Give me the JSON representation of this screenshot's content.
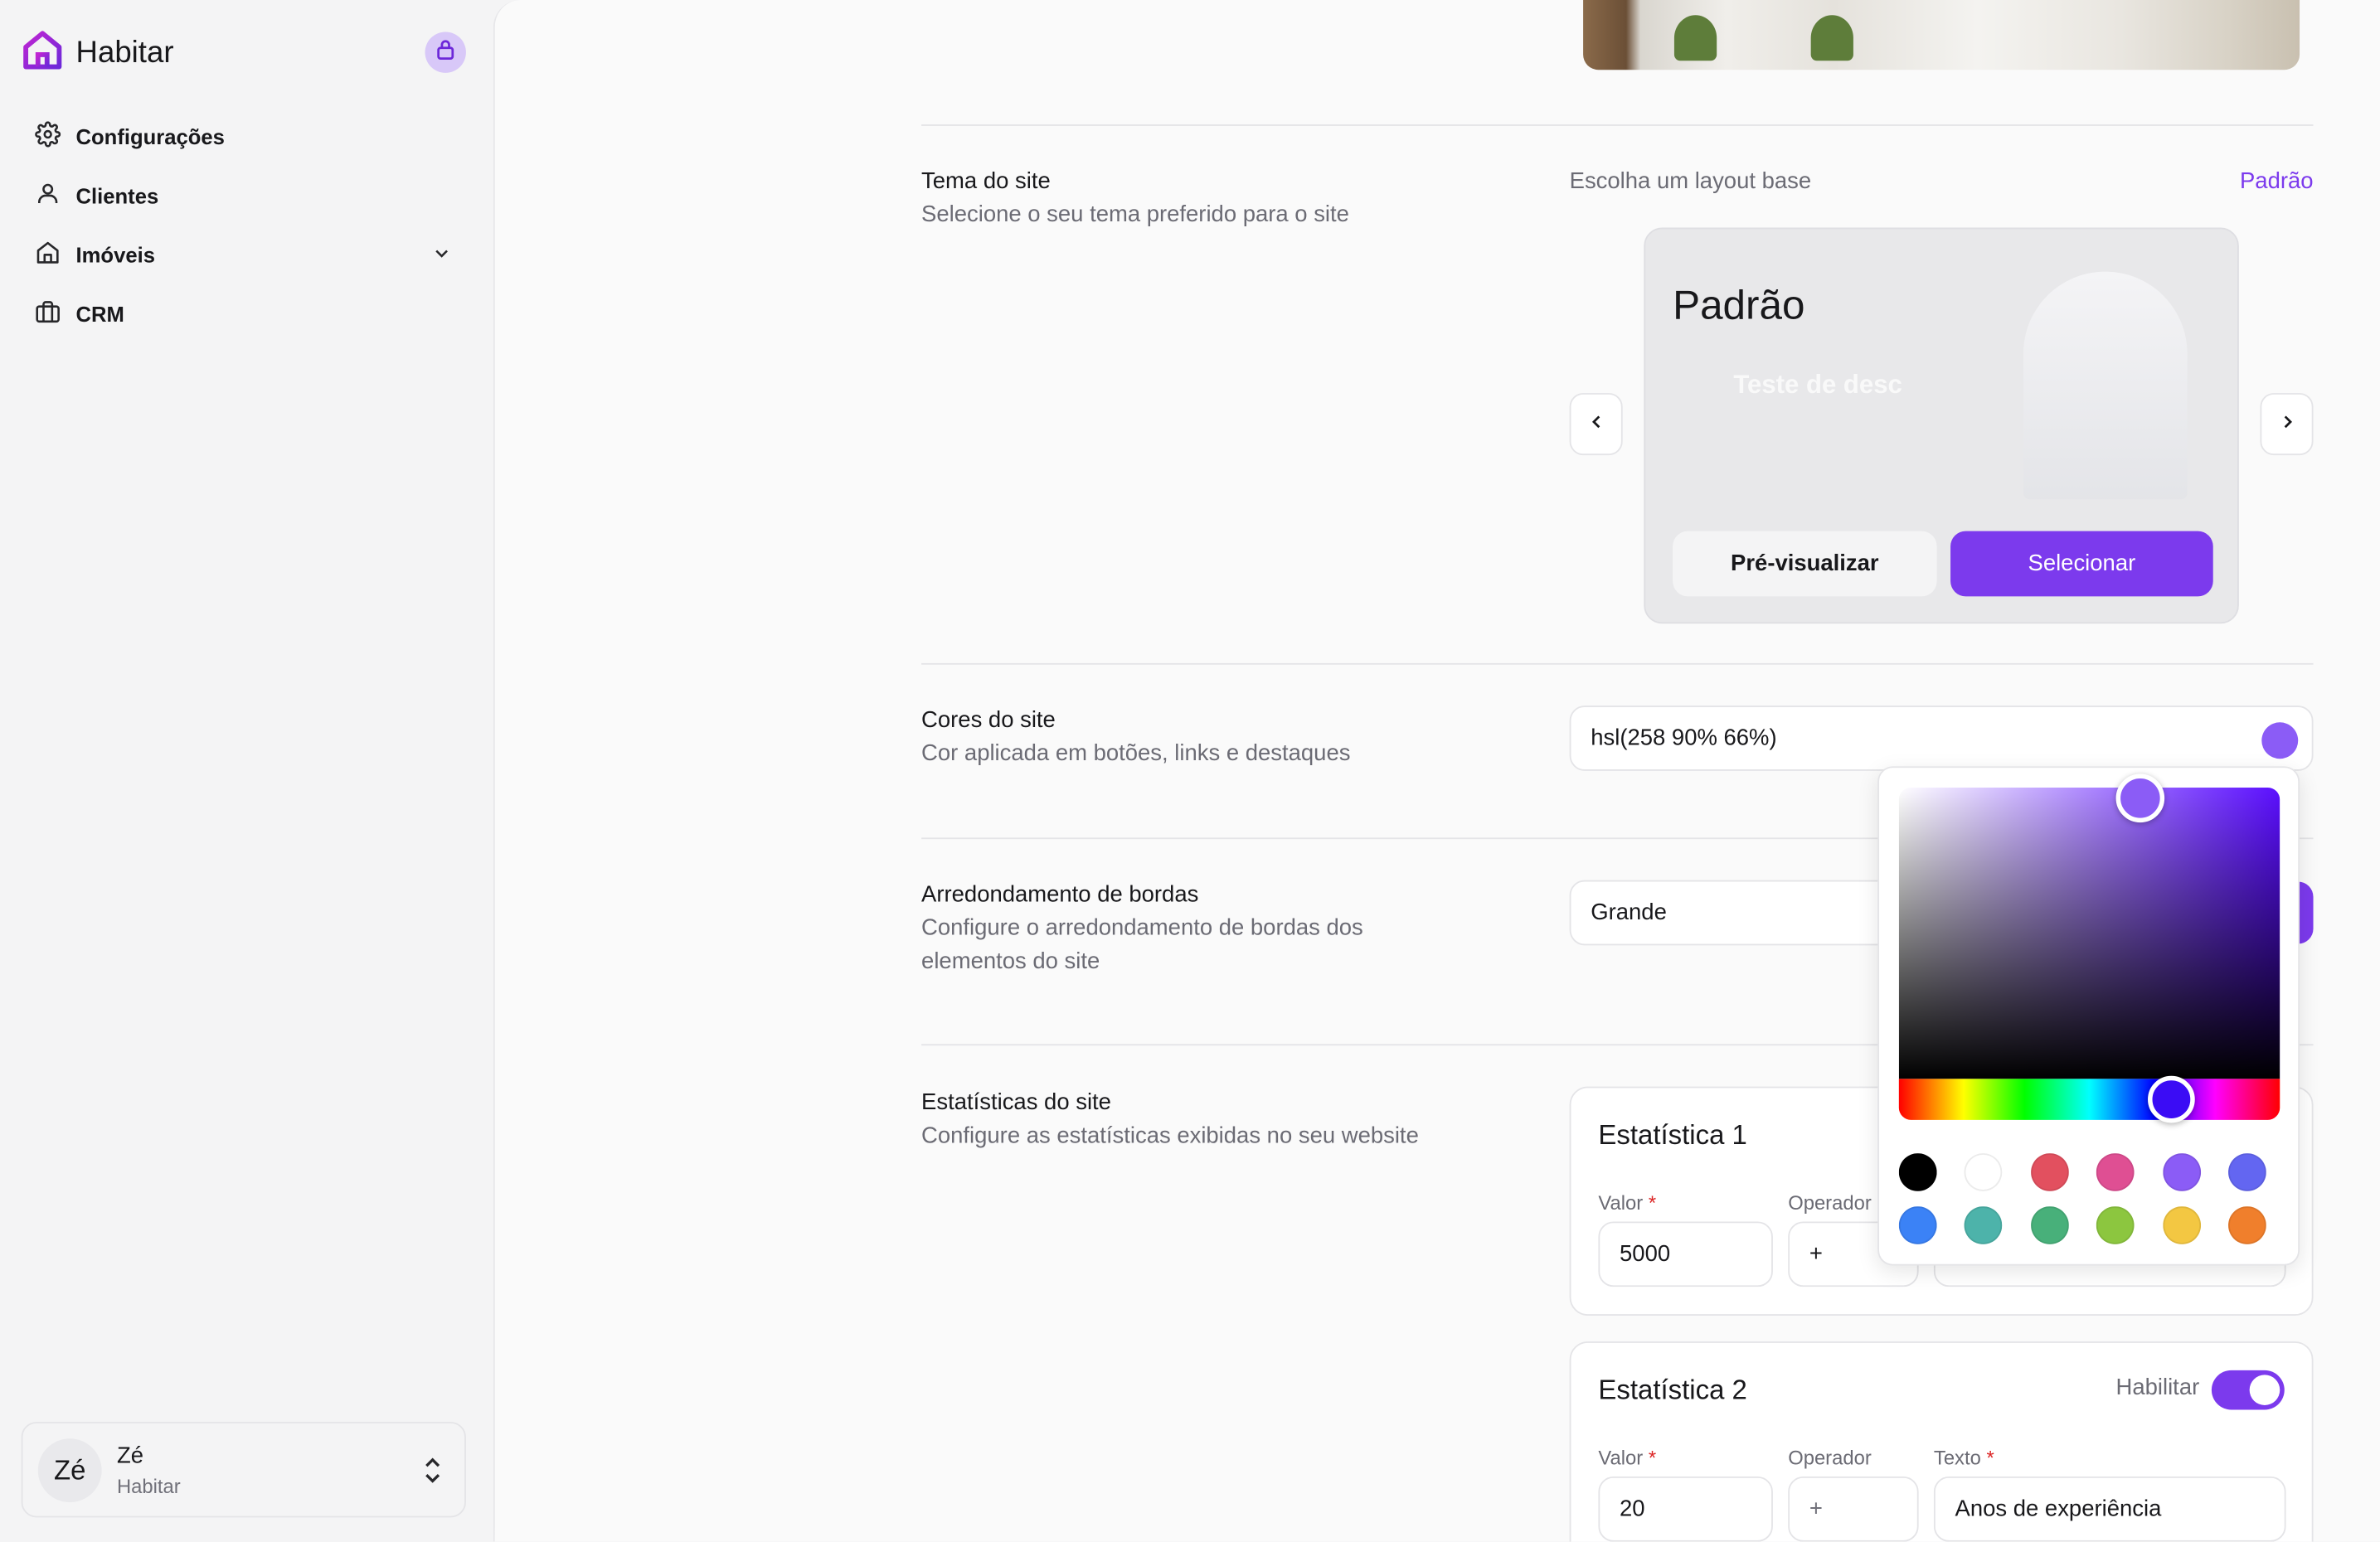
{
  "app": {
    "name": "Habitar"
  },
  "sidebar": {
    "items": [
      {
        "label": "Configurações",
        "icon": "gear-icon"
      },
      {
        "label": "Clientes",
        "icon": "user-icon"
      },
      {
        "label": "Imóveis",
        "icon": "home-icon"
      },
      {
        "label": "CRM",
        "icon": "briefcase-icon"
      }
    ]
  },
  "user": {
    "initials": "Zé",
    "name": "Zé",
    "org": "Habitar"
  },
  "theme": {
    "title": "Tema do site",
    "description": "Selecione o seu tema preferido para o site",
    "layout_label": "Escolha um layout base",
    "current": "Padrão",
    "card_name": "Padrão",
    "card_ghost_title": "Teste de desc",
    "preview_label": "Pré-visualizar",
    "select_label": "Selecionar"
  },
  "colors": {
    "title": "Cores do site",
    "description": "Cor aplicada em botões, links e destaques",
    "value": "hsl(258 90% 66%)",
    "accent": "#8b5cf6",
    "presets": [
      "#000000",
      "#ffffff",
      "#e2505f",
      "#df4f93",
      "#8b5cf6",
      "#6366f1",
      "#3b82f6",
      "#4db3aa",
      "#48b07a",
      "#8cc63f",
      "#f3c742",
      "#f07f2c"
    ]
  },
  "borders": {
    "title": "Arredondamento de bordas",
    "description": "Configure o arredondamento de bordas dos elementos do site",
    "value": "Grande"
  },
  "stats": {
    "title": "Estatísticas do site",
    "description": "Configure as estatísticas exibidas no seu website",
    "value_label": "Valor",
    "operator_label": "Operador",
    "text_label": "Texto",
    "required_mark": "*",
    "enable_label": "Habilitar",
    "items": [
      {
        "title": "Estatística 1",
        "value": "5000",
        "operator": "+"
      },
      {
        "title": "Estatística 2",
        "value": "20",
        "operator": "+",
        "text": "Anos de experiência"
      }
    ]
  }
}
